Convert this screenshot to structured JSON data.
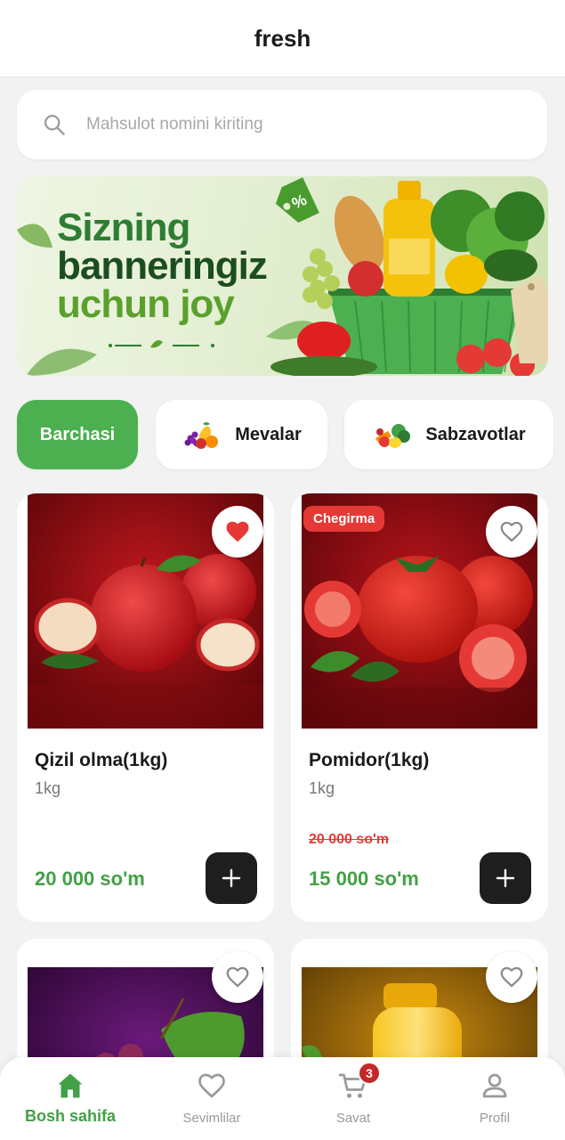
{
  "app": {
    "title": "fresh"
  },
  "search": {
    "placeholder": "Mahsulot nomini kiriting",
    "value": ""
  },
  "banner": {
    "line1": "Sizning",
    "line2": "banneringiz",
    "line3": "uchun joy",
    "tag_icon": "percent-tag-icon"
  },
  "categories": [
    {
      "label": "Barchasi",
      "active": true
    },
    {
      "label": "Mevalar",
      "icon": "fruits-icon"
    },
    {
      "label": "Sabzavotlar",
      "icon": "vegetables-icon"
    }
  ],
  "products": [
    {
      "name": "Qizil olma(1kg)",
      "unit": "1kg",
      "price": "20 000 so'm",
      "favorite": true
    },
    {
      "name": "Pomidor(1kg)",
      "unit": "1kg",
      "old_price": "20 000 so'm",
      "price": "15 000 so'm",
      "badge": "Chegirma",
      "favorite": false
    },
    {
      "image": "grapes",
      "favorite": false
    },
    {
      "image": "sunflower-oil",
      "favorite": false
    }
  ],
  "nav": {
    "items": [
      {
        "label": "Bosh sahifa",
        "icon": "home-icon",
        "active": true
      },
      {
        "label": "Sevimlilar",
        "icon": "heart-icon"
      },
      {
        "label": "Savat",
        "icon": "cart-icon",
        "badge": "3"
      },
      {
        "label": "Profil",
        "icon": "person-icon"
      }
    ]
  },
  "colors": {
    "accent": "#4caf50",
    "price": "#43a047",
    "discount": "#e53935",
    "dark_button": "#1e1e1e"
  }
}
